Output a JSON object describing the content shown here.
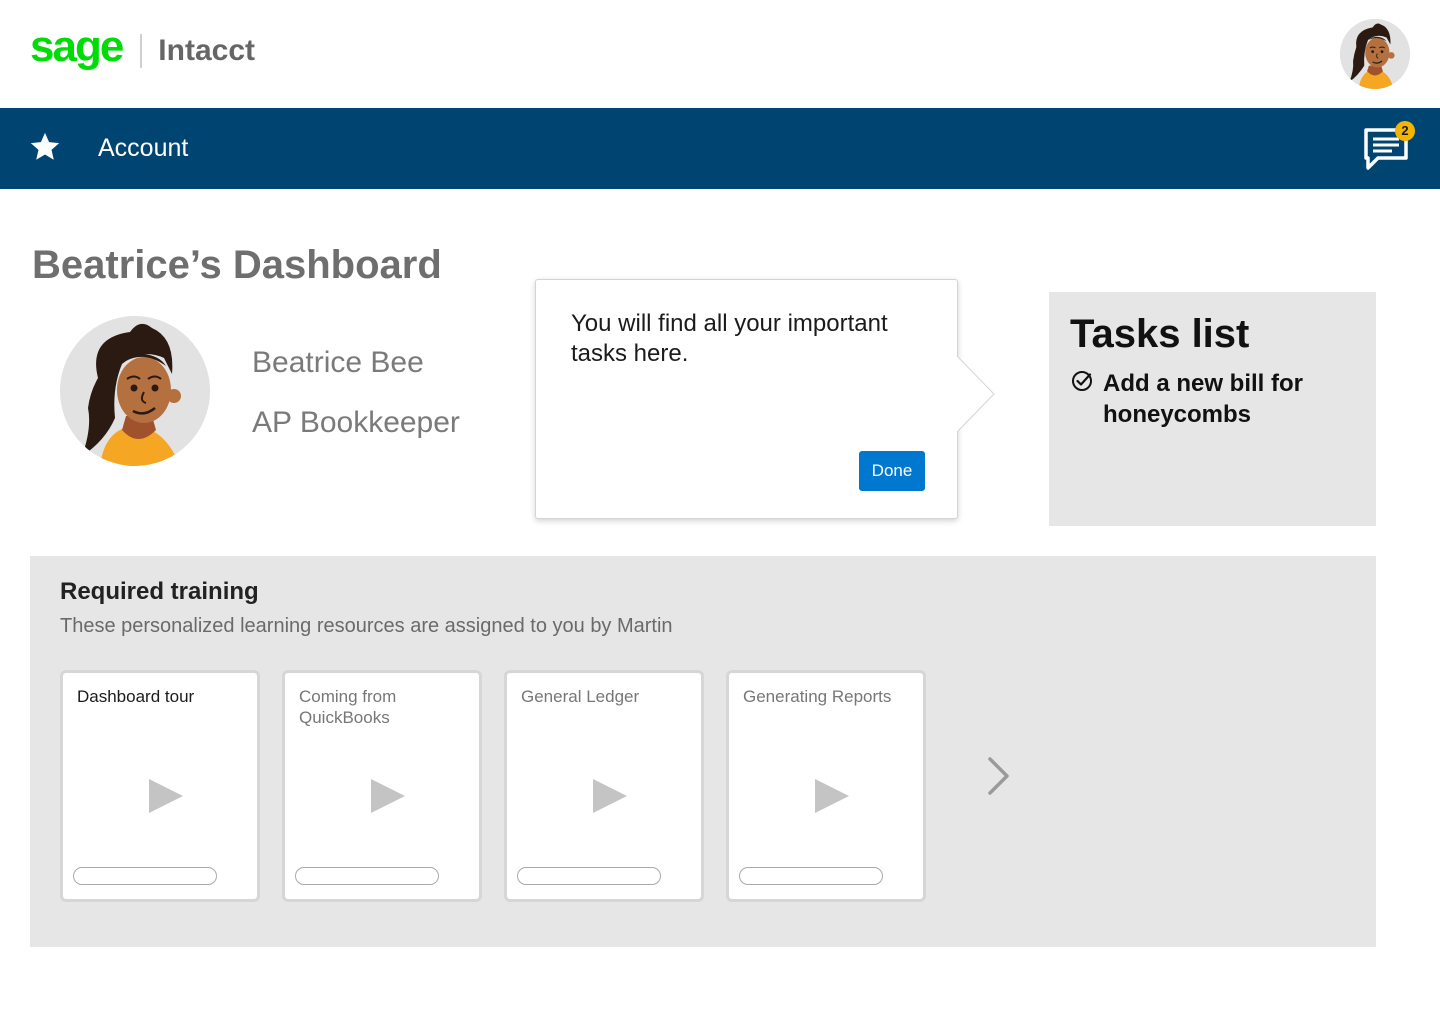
{
  "header": {
    "logo_brand": "sage",
    "logo_product": "Intacct",
    "avatar_icon": "user-avatar-icon"
  },
  "nav": {
    "star_icon": "star-icon",
    "label": "Account",
    "chat_icon": "chat-icon",
    "notification_count": "2"
  },
  "dashboard": {
    "title": "Beatrice’s Dashboard",
    "user": {
      "name": "Beatrice Bee",
      "role": "AP Bookkeeper"
    }
  },
  "popover": {
    "text": "You will find all your important tasks here.",
    "button_label": "Done"
  },
  "tasks": {
    "title": "Tasks list",
    "items": [
      {
        "label": "Add a new bill for honeycombs",
        "icon": "check-circle-icon"
      }
    ]
  },
  "training": {
    "title": "Required training",
    "subtitle": "These personalized learning resources are assigned to you by Martin",
    "cards": [
      {
        "title": "Dashboard tour",
        "progress": 0
      },
      {
        "title": "Coming from QuickBooks",
        "progress": 0
      },
      {
        "title": "General Ledger",
        "progress": 0
      },
      {
        "title": "Generating Reports",
        "progress": 0
      }
    ],
    "next_icon": "chevron-right-icon"
  },
  "colors": {
    "brand_green": "#00dc06",
    "nav_blue": "#004472",
    "button_blue": "#0078d0",
    "badge_yellow": "#f5b400",
    "panel_gray": "#e6e6e6"
  }
}
